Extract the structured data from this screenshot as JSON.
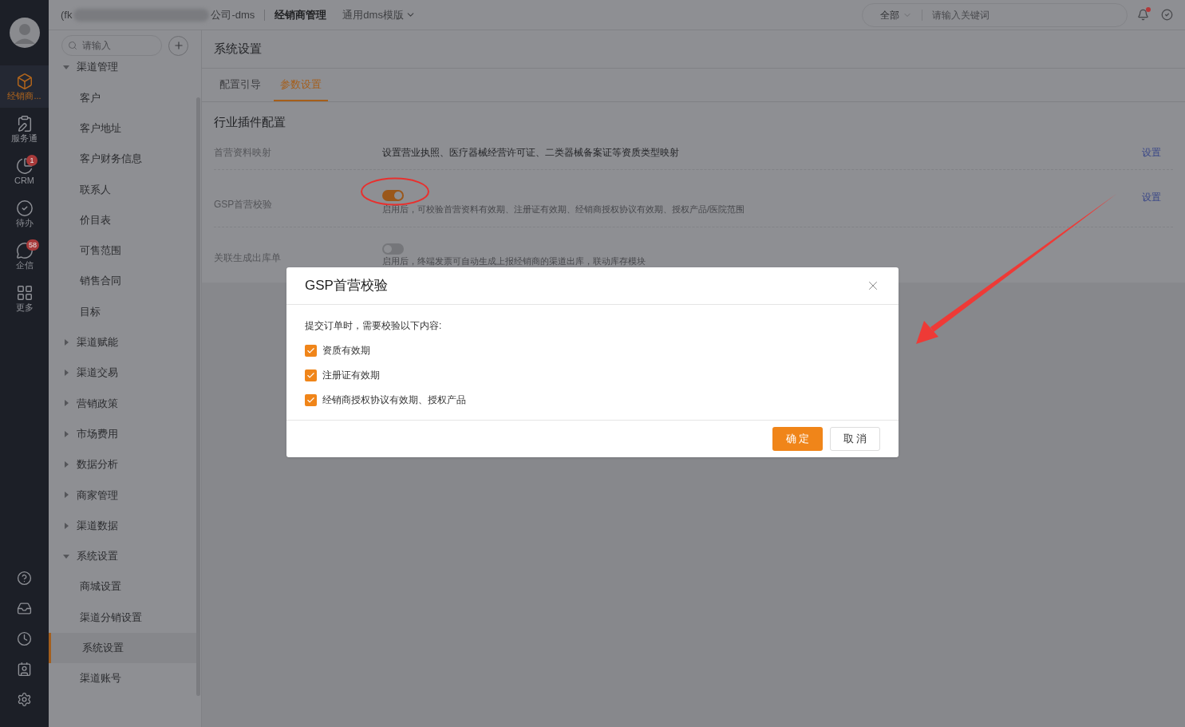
{
  "header": {
    "company_prefix": "(fk",
    "company_suffix": "公司-dms",
    "module": "经销商管理",
    "template": "通用dms模版",
    "search_scope": "全部",
    "search_placeholder": "请输入关键词"
  },
  "rail": {
    "items": [
      {
        "label": "经销商...",
        "selected": true
      },
      {
        "label": "服务通",
        "selected": false
      },
      {
        "label": "CRM",
        "selected": false,
        "badge": "1"
      },
      {
        "label": "待办",
        "selected": false
      },
      {
        "label": "企信",
        "selected": false,
        "badge": "58"
      },
      {
        "label": "更多",
        "selected": false
      }
    ]
  },
  "sidebar": {
    "search_placeholder": "请输入",
    "tree": [
      {
        "label": "渠道管理",
        "expanded": true,
        "children": [
          {
            "label": "客户",
            "selected": false
          },
          {
            "label": "客户地址",
            "selected": false
          },
          {
            "label": "客户财务信息",
            "selected": false
          },
          {
            "label": "联系人",
            "selected": false
          },
          {
            "label": "价目表",
            "selected": false
          },
          {
            "label": "可售范围",
            "selected": false
          },
          {
            "label": "销售合同",
            "selected": false
          },
          {
            "label": "目标",
            "selected": false
          }
        ]
      },
      {
        "label": "渠道赋能",
        "expanded": false
      },
      {
        "label": "渠道交易",
        "expanded": false
      },
      {
        "label": "营销政策",
        "expanded": false
      },
      {
        "label": "市场费用",
        "expanded": false
      },
      {
        "label": "数据分析",
        "expanded": false
      },
      {
        "label": "商家管理",
        "expanded": false
      },
      {
        "label": "渠道数据",
        "expanded": false
      },
      {
        "label": "系统设置",
        "expanded": true,
        "children": [
          {
            "label": "商城设置",
            "selected": false
          },
          {
            "label": "渠道分销设置",
            "selected": false
          },
          {
            "label": "系统设置",
            "selected": true
          },
          {
            "label": "渠道账号",
            "selected": false
          }
        ]
      }
    ]
  },
  "main": {
    "title": "系统设置",
    "tabs": [
      {
        "label": "配置引导",
        "selected": false
      },
      {
        "label": "参数设置",
        "selected": true
      }
    ],
    "section": "行业插件配置",
    "rows": [
      {
        "kind": "text",
        "label": "首营资料映射",
        "description": "设置营业执照、医疗器械经营许可证、二类器械备案证等资质类型映射",
        "action": "设置"
      },
      {
        "kind": "toggle",
        "label": "GSP首营校验",
        "on": true,
        "description": "启用后，可校验首营资料有效期、注册证有效期、经销商授权协议有效期、授权产品/医院范围",
        "action": "设置"
      },
      {
        "kind": "toggle",
        "label": "关联生成出库单",
        "on": false,
        "description": "启用后，终端发票可自动生成上报经销商的渠道出库，联动库存模块"
      }
    ]
  },
  "dialog": {
    "title": "GSP首营校验",
    "prompt": "提交订单时，需要校验以下内容:",
    "options": [
      {
        "label": "资质有效期",
        "checked": true
      },
      {
        "label": "注册证有效期",
        "checked": true
      },
      {
        "label": "经销商授权协议有效期、授权产品",
        "checked": true
      }
    ],
    "confirm": "确 定",
    "cancel": "取 消"
  }
}
